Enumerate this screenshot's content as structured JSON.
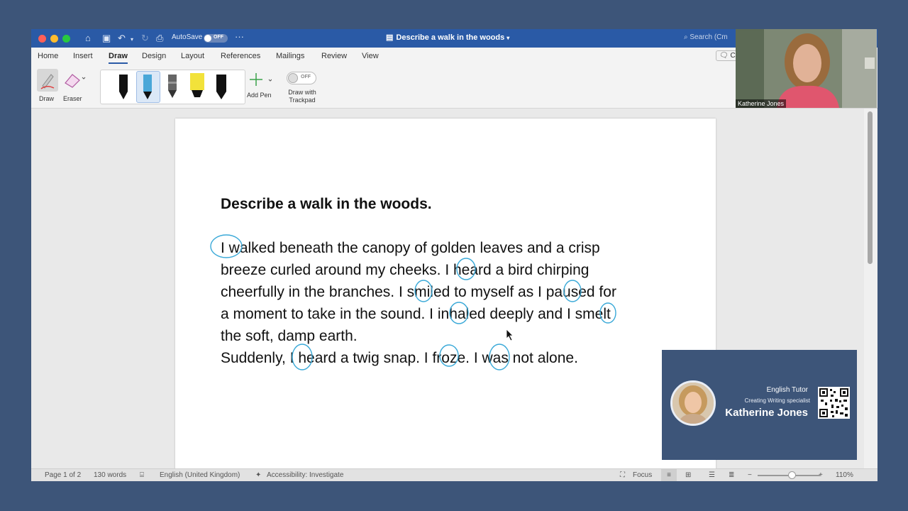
{
  "window": {
    "title": "Describe a walk in the woods",
    "autosave_label": "AutoSave",
    "autosave_state": "OFF",
    "search_placeholder": "Search (Cm"
  },
  "menu_tabs": [
    "Home",
    "Insert",
    "Draw",
    "Design",
    "Layout",
    "References",
    "Mailings",
    "Review",
    "View"
  ],
  "active_tab": "Draw",
  "ribbon": {
    "draw_label": "Draw",
    "eraser_label": "Eraser",
    "add_pen_label": "Add Pen",
    "draw_trackpad_label": "Draw with Trackpad",
    "trackpad_state": "OFF",
    "comments_partial": "Co",
    "pens": [
      {
        "name": "black-pen",
        "color": "#111111"
      },
      {
        "name": "blue-pen",
        "color": "#4aa7d8"
      },
      {
        "name": "gray-pencil",
        "color": "#555555"
      },
      {
        "name": "yellow-highlighter",
        "color": "#f2e23a"
      },
      {
        "name": "black-marker",
        "color": "#111111"
      }
    ]
  },
  "document": {
    "heading": "Describe a walk in the woods.",
    "lines": [
      "I walked beneath the canopy of golden leaves and a crisp",
      "breeze curled around my cheeks. I heard a bird chirping",
      "cheerfully in the branches. I smiled to myself as I paused for",
      "a moment to take in the sound. I inhaled deeply and I smelt",
      "the soft, damp earth.",
      "Suddenly, I heard a twig snap. I froze. I was not alone."
    ],
    "ink_color": "#3aa9d8"
  },
  "status": {
    "page": "Page 1 of 2",
    "words": "130 words",
    "language": "English (United Kingdom)",
    "accessibility": "Accessibility: Investigate",
    "focus": "Focus",
    "zoom": "110%",
    "zoom_fraction": 0.55
  },
  "webcam": {
    "name": "Katherine Jones"
  },
  "tutor_card": {
    "role": "English Tutor",
    "specialty": "Creating Writing specialist",
    "name": "Katherine Jones"
  }
}
